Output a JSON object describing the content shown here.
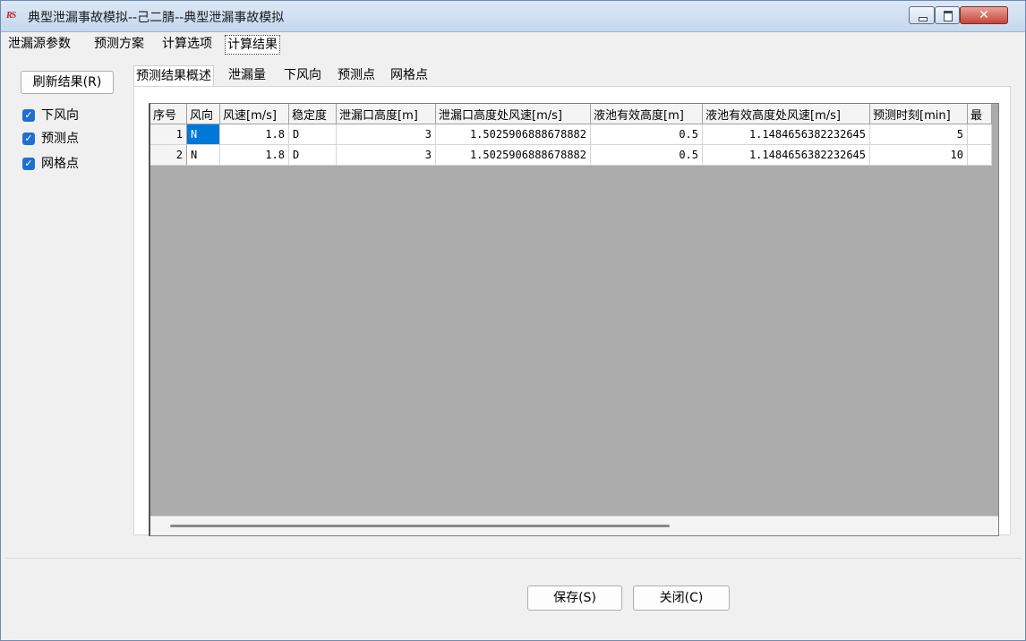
{
  "window": {
    "icon_text": "RS",
    "title": "典型泄漏事故模拟--己二腈--典型泄漏事故模拟",
    "controls": {
      "minimize": "—",
      "maximize": "□",
      "close": "✕"
    }
  },
  "main_tabs": [
    "泄漏源参数",
    "预测方案",
    "计算选项",
    "计算结果"
  ],
  "left_panel": {
    "refresh_label": "刷新结果(R)",
    "checkboxes": [
      {
        "label": "下风向",
        "checked": true
      },
      {
        "label": "预测点",
        "checked": true
      },
      {
        "label": "网格点",
        "checked": true
      }
    ]
  },
  "sub_tabs": [
    "预测结果概述",
    "泄漏量",
    "下风向",
    "预测点",
    "网格点"
  ],
  "table": {
    "headers": [
      "序号",
      "风向",
      "风速[m/s]",
      "稳定度",
      "泄漏口高度[m]",
      "泄漏口高度处风速[m/s]",
      "液池有效高度[m]",
      "液池有效高度处风速[m/s]",
      "预测时刻[min]",
      "最"
    ],
    "rows": [
      [
        "1",
        "N",
        "1.8",
        "D",
        "3",
        "1.5025906888678882",
        "0.5",
        "1.1484656382232645",
        "5",
        ""
      ],
      [
        "2",
        "N",
        "1.8",
        "D",
        "3",
        "1.5025906888678882",
        "0.5",
        "1.1484656382232645",
        "10",
        ""
      ]
    ]
  },
  "buttons": {
    "save": "保存(S)",
    "close": "关闭(C)"
  },
  "colors": {
    "selection": "#0078d7",
    "checkbox": "#1f6fd0",
    "grid_empty": "#ababab"
  }
}
